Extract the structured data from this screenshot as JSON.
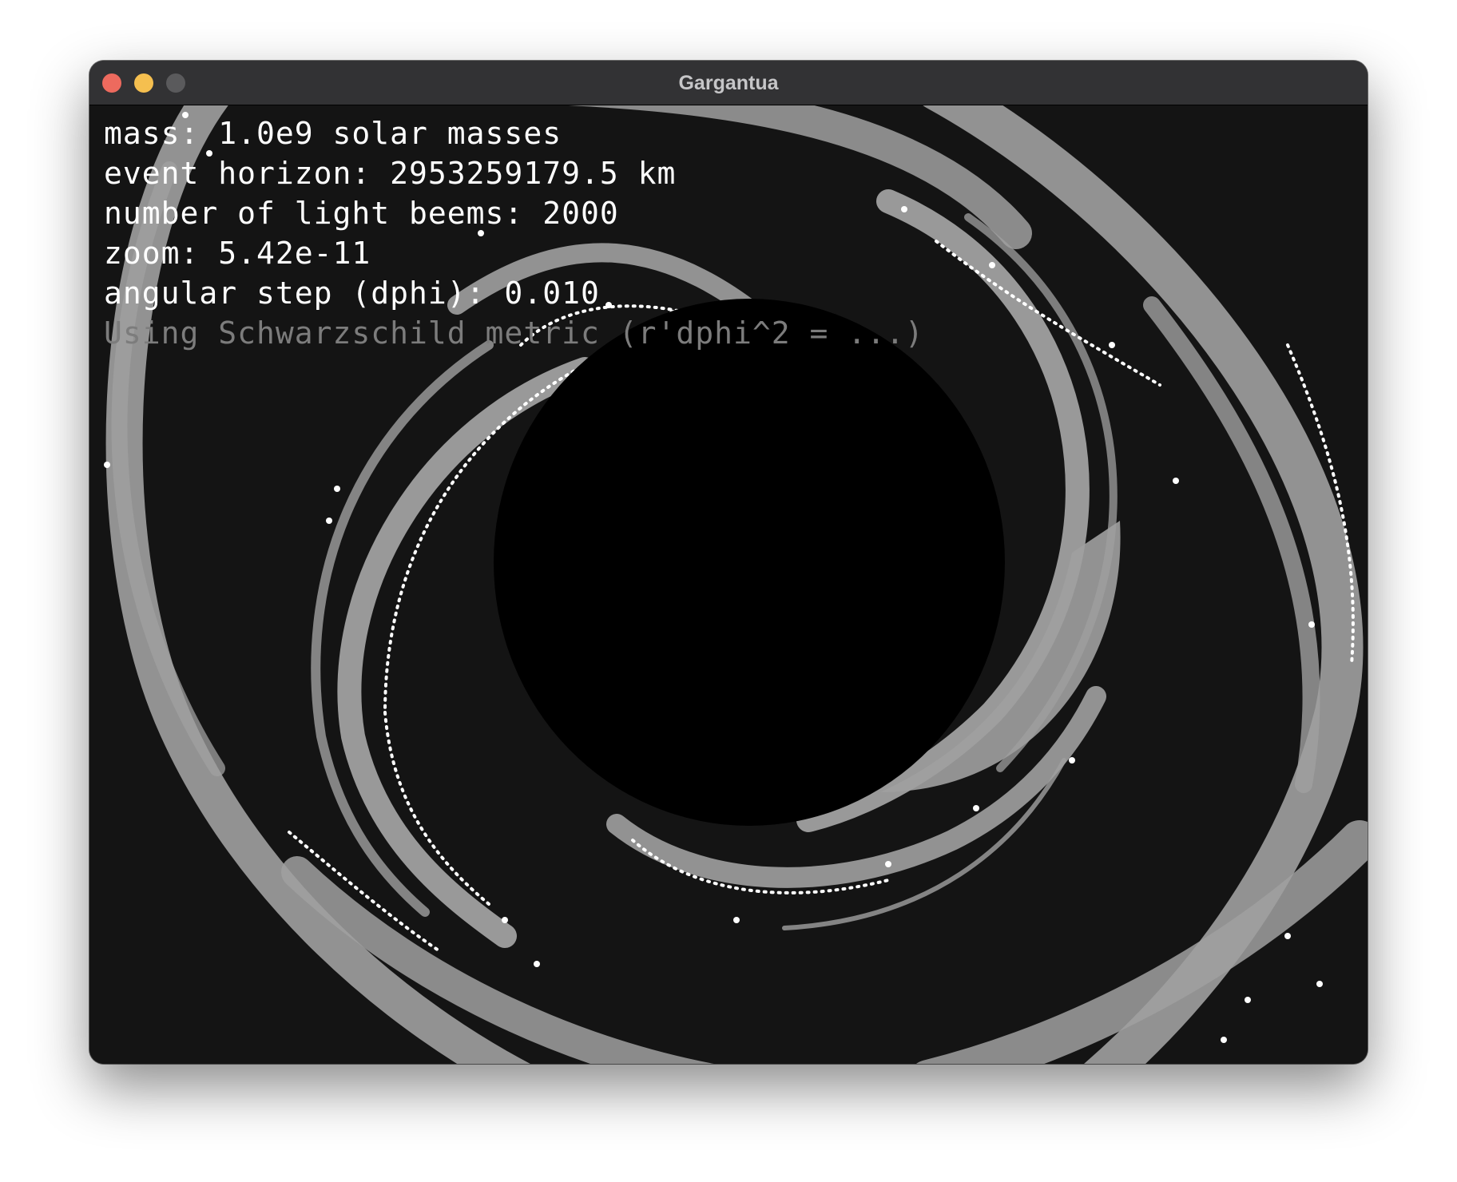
{
  "window": {
    "title": "Gargantua"
  },
  "hud": {
    "mass": "mass: 1.0e9 solar masses",
    "event_horizon": "event horizon: 2953259179.5 km",
    "light_beams": "number of light beems: 2000",
    "zoom": "zoom: 5.42e-11",
    "angular_step": "angular step (dphi): 0.010",
    "metric_note": "Using Schwarzschild metric (r'dphi^2 = ...)"
  },
  "colors": {
    "background": "#141414",
    "event_horizon": "#000000",
    "light_ray": "#a0a0a0",
    "photon": "#ffffff",
    "title_bar": "#323234"
  }
}
